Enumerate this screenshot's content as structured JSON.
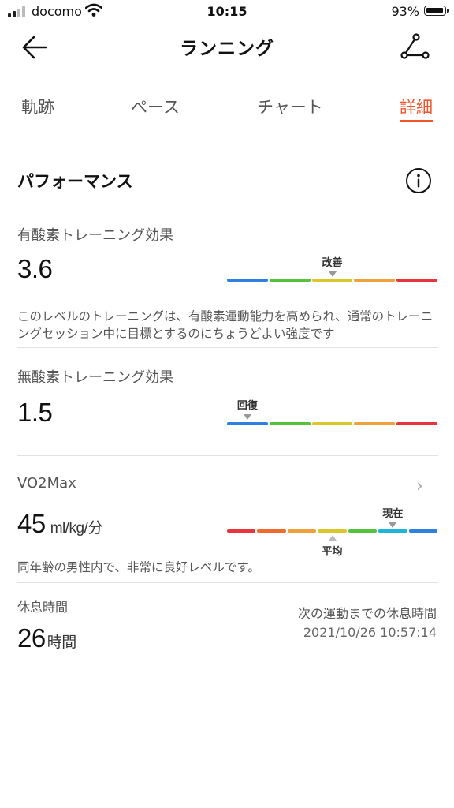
{
  "status_bar": {
    "carrier": "docomo",
    "time": "10:15",
    "battery": "93%"
  },
  "header": {
    "title": "ランニング"
  },
  "tabs": [
    {
      "label": "軌跡"
    },
    {
      "label": "ペース"
    },
    {
      "label": "チャート"
    },
    {
      "label": "詳細"
    }
  ],
  "active_tab": "詳細",
  "performance": {
    "title": "パフォーマンス",
    "aerobic": {
      "label": "有酸素トレーニング効果",
      "value": "3.6",
      "marker_label": "改善",
      "level_segment": 3,
      "description": "このレベルのトレーニングは、有酸素運動能力を高められ、通常のトレーニングセッション中に目標とするのにちょうどよい強度です"
    },
    "anaerobic": {
      "label": "無酸素トレーニング効果",
      "value": "1.5",
      "marker_label": "回復",
      "level_segment": 1
    },
    "vo2max": {
      "label": "VO2Max",
      "value": "45",
      "unit": "ml/kg/分",
      "current_label": "現在",
      "average_label": "平均",
      "current_segment": 6,
      "average_segment": 4,
      "description": "同年齢の男性内で、非常に良好レベルです。"
    },
    "rest": {
      "label": "休息時間",
      "value": "26",
      "unit": "時間",
      "next_label": "次の運動までの休息時間",
      "next_time": "2021/10/26 10:57:14"
    }
  },
  "colors": {
    "accent": "#f0562a",
    "scale5": [
      "#2f7fe0",
      "#55c23c",
      "#dcc72a",
      "#efa23a",
      "#e8343c"
    ],
    "scale7": [
      "#e8343c",
      "#f06a2c",
      "#efa23a",
      "#dcc72a",
      "#55c23c",
      "#1fb4d8",
      "#2f7fe0"
    ]
  }
}
